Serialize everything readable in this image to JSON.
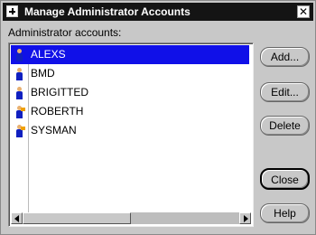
{
  "window": {
    "title": "Manage Administrator Accounts",
    "close_glyph": "✕"
  },
  "list": {
    "label": "Administrator accounts:",
    "items": [
      {
        "name": "ALEXS",
        "selected": true,
        "icon": "admin-user-icon"
      },
      {
        "name": "BMD",
        "selected": false,
        "icon": "admin-user-icon"
      },
      {
        "name": "BRIGITTED",
        "selected": false,
        "icon": "admin-user-icon"
      },
      {
        "name": "ROBERTH",
        "selected": false,
        "icon": "admin-user-key-icon"
      },
      {
        "name": "SYSMAN",
        "selected": false,
        "icon": "admin-user-key-icon"
      }
    ]
  },
  "buttons": {
    "add": "Add...",
    "edit": "Edit...",
    "delete": "Delete",
    "close": "Close",
    "help": "Help"
  },
  "colors": {
    "titlebar": "#141414",
    "selection": "#1010e8",
    "window_bg": "#c8c8c8"
  }
}
